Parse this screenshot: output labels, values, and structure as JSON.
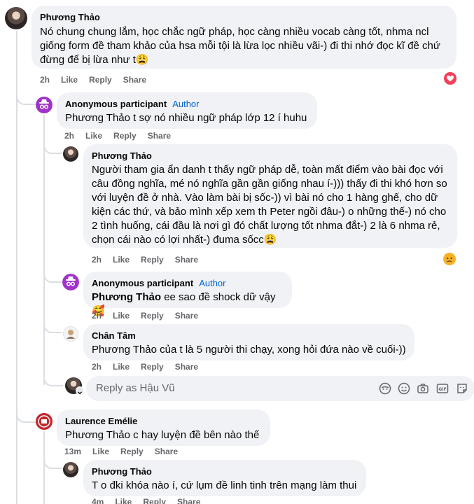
{
  "comments": [
    {
      "name": "Phương Thảo",
      "text": "Nó chung chung lắm, học chắc ngữ pháp, học càng nhiều vocab càng tốt, nhma ncl giống form đề tham khảo của hsa mỗi tội là lừa lọc nhiều vãi-) đi thi nhớ đọc kĩ đề chứ đừng để bị lừa như t😩",
      "time": "2h",
      "like": "Like",
      "reply": "Reply",
      "share": "Share"
    },
    {
      "name": "Anonymous participant",
      "badge": "Author",
      "text": "Phương Thảo t sợ nó nhiều ngữ pháp lớp 12 í huhu",
      "time": "2h",
      "like": "Like",
      "reply": "Reply",
      "share": "Share"
    },
    {
      "name": "Phương Thảo",
      "text": "Người tham gia ẩn danh t thấy ngữ pháp dễ, toàn mất điểm vào bài đọc với câu đồng nghĩa, mé nó nghĩa gần gần giống nhau í-))) thấy đi thi khó hơn so với luyện đề ở nhà. Vào làm bài bị sốc-)) vì bài nó cho 1 hàng ghế, cho dữ kiện các thứ, và bảo mình xếp xem th Peter ngồi đâu-) o những thế-) nó cho 2 tình huống, cái đầu là nơi gì đó chất lượng tốt nhma đắt-) 2 là 6 nhma rẻ, chọn cái nào có lợi nhất-) đuma sốcc😩",
      "time": "2h",
      "like": "Like",
      "reply": "Reply",
      "share": "Share"
    },
    {
      "name": "Anonymous participant",
      "badge": "Author",
      "mention": "Phương Thảo",
      "text": " ee sao đề shock dữ vậy🥰",
      "time": "2h",
      "like": "Like",
      "reply": "Reply",
      "share": "Share"
    },
    {
      "name": "Chân Tâm",
      "text": "Phương Thảo của t là 5 người thi chạy, xong hỏi đứa nào về cuối-))",
      "time": "2h",
      "like": "Like",
      "reply": "Reply",
      "share": "Share"
    },
    {
      "name": "Laurence Emélie",
      "text": "Phương Thảo c hay luyện đề bên nào thế",
      "time": "13m",
      "like": "Like",
      "reply": "Reply",
      "share": "Share"
    },
    {
      "name": "Phương Thảo",
      "text": "T o đki khóa nào í, cứ lụm đề linh tinh trên mạng làm thui",
      "time": "4m",
      "like": "Like",
      "reply": "Reply",
      "share": "Share"
    }
  ],
  "reply_box": {
    "placeholder": "Reply as Hậu Vũ"
  },
  "colors": {
    "bubble": "#f0f2f5",
    "author": "#0064d1",
    "muted": "#65676b",
    "love": "#f33e58",
    "sad": "#f7b125"
  }
}
